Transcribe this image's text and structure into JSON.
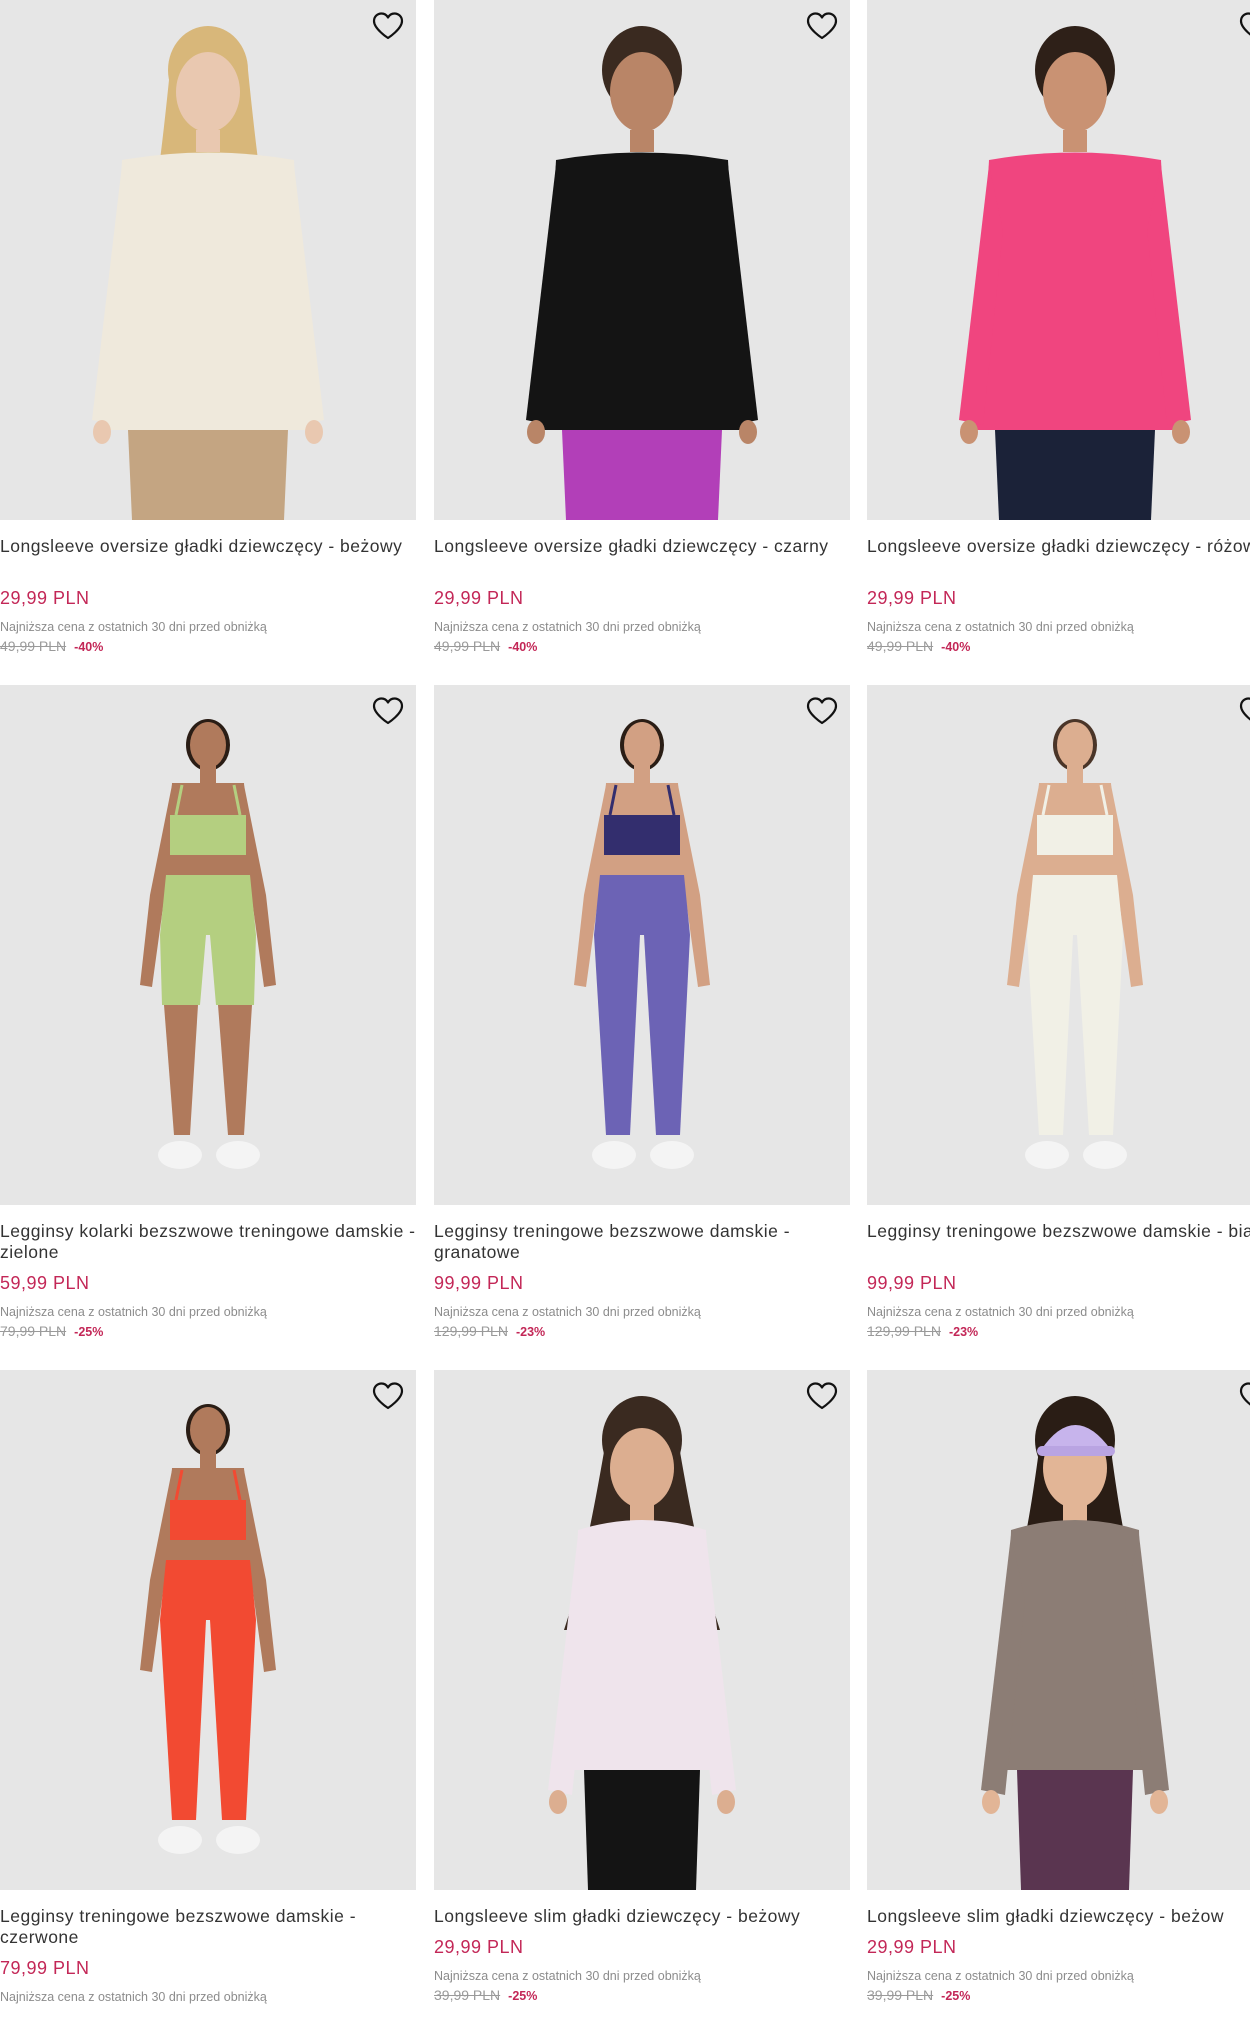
{
  "products": [
    {
      "title": "Longsleeve oversize gładki dziewczęcy - beżowy",
      "price": "29,99 PLN",
      "lowest_note": "Najniższa cena z ostatnich 30 dni przed obniżką",
      "old_price": "49,99 PLN",
      "discount": "-40%",
      "image": {
        "top": "#efe9dc",
        "bottom": "#c4a582",
        "hair": "#d8b77a",
        "skin": "#e9c8b0",
        "style": "longsleeve-pants",
        "icon": "product-photo"
      }
    },
    {
      "title": "Longsleeve oversize gładki dziewczęcy - czarny",
      "price": "29,99 PLN",
      "lowest_note": "Najniższa cena z ostatnich 30 dni przed obniżką",
      "old_price": "49,99 PLN",
      "discount": "-40%",
      "image": {
        "top": "#141414",
        "bottom": "#b23fb8",
        "hair": "#3a2a20",
        "skin": "#b98567",
        "style": "longsleeve-pants",
        "icon": "product-photo"
      }
    },
    {
      "title": "Longsleeve oversize gładki dziewczęcy - różowy",
      "price": "29,99 PLN",
      "lowest_note": "Najniższa cena z ostatnich 30 dni przed obniżką",
      "old_price": "49,99 PLN",
      "discount": "-40%",
      "image": {
        "top": "#f0457f",
        "bottom": "#1b2238",
        "hair": "#2e2018",
        "skin": "#c99273",
        "style": "longsleeve-pants",
        "icon": "product-photo"
      }
    },
    {
      "title": "Legginsy kolarki bezszwowe treningowe damskie - zielone",
      "price": "59,99 PLN",
      "lowest_note": "Najniższa cena z ostatnich 30 dni przed obniżką",
      "old_price": "79,99 PLN",
      "discount": "-25%",
      "image": {
        "top": "#b4cf80",
        "bottom": "#b4cf80",
        "hair": "#2a1d15",
        "skin": "#b07a5c",
        "style": "bra-shorts",
        "icon": "product-photo"
      }
    },
    {
      "title": "Legginsy treningowe bezszwowe damskie - granatowe",
      "price": "99,99 PLN",
      "lowest_note": "Najniższa cena z ostatnich 30 dni przed obniżką",
      "old_price": "129,99 PLN",
      "discount": "-23%",
      "image": {
        "top": "#332e6e",
        "bottom": "#6c63b5",
        "hair": "#2a1d15",
        "skin": "#d2a083",
        "style": "bra-leggings",
        "icon": "product-photo"
      }
    },
    {
      "title": "Legginsy treningowe bezszwowe damskie - białe",
      "price": "99,99 PLN",
      "lowest_note": "Najniższa cena z ostatnich 30 dni przed obniżką",
      "old_price": "129,99 PLN",
      "discount": "-23%",
      "image": {
        "top": "#f1f0e6",
        "bottom": "#f1f0e6",
        "hair": "#4a3528",
        "skin": "#dcae90",
        "style": "bra-leggings",
        "icon": "product-photo"
      }
    },
    {
      "title": "Legginsy treningowe bezszwowe damskie - czerwone",
      "price": "79,99 PLN",
      "lowest_note": "Najniższa cena z ostatnich 30 dni przed obniżką",
      "old_price": "",
      "discount": "",
      "image": {
        "top": "#f24a32",
        "bottom": "#f24a32",
        "hair": "#2a1d15",
        "skin": "#b07a5c",
        "style": "bra-leggings",
        "icon": "product-photo"
      }
    },
    {
      "title": "Longsleeve slim gładki dziewczęcy - beżowy",
      "price": "29,99 PLN",
      "lowest_note": "Najniższa cena z ostatnich 30 dni przed obniżką",
      "old_price": "39,99 PLN",
      "discount": "-25%",
      "image": {
        "top": "#efe4ec",
        "bottom": "#141414",
        "hair": "#3a2a20",
        "skin": "#dcae90",
        "style": "slim-pants",
        "icon": "product-photo"
      }
    },
    {
      "title": "Longsleeve slim gładki dziewczęcy - beżow",
      "price": "29,99 PLN",
      "lowest_note": "Najniższa cena z ostatnich 30 dni przed obniżką",
      "old_price": "39,99 PLN",
      "discount": "-25%",
      "image": {
        "top": "#8c7d75",
        "bottom": "#5a3550",
        "hair": "#2a1d15",
        "skin": "#e2b596",
        "style": "slim-pants-cap",
        "icon": "product-photo"
      }
    }
  ],
  "wishlist_icon": "heart-outline-icon",
  "colors": {
    "price": "#c32757",
    "background": "#e6e6e6"
  }
}
